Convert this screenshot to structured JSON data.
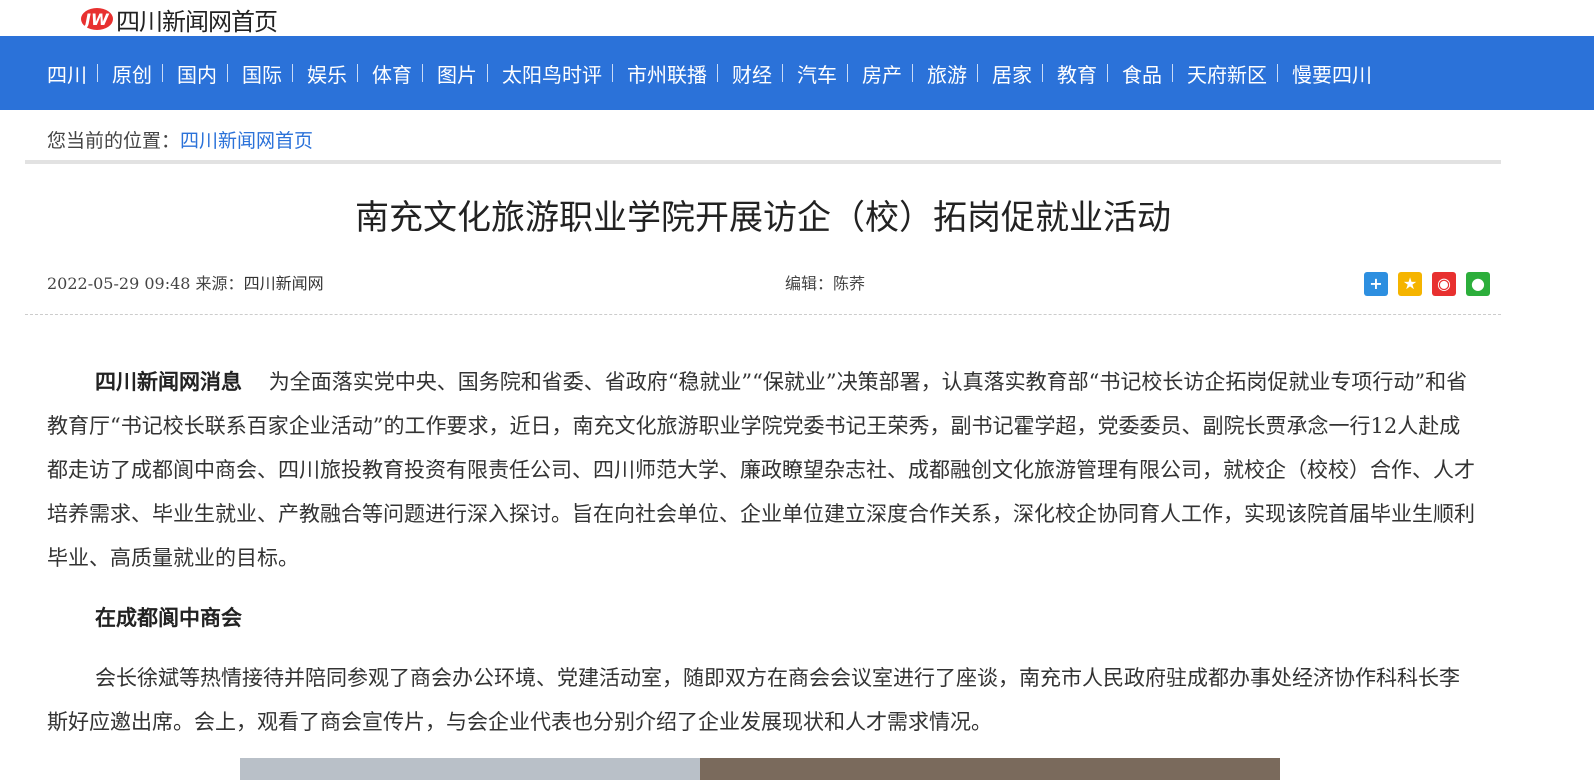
{
  "site": {
    "logo_text": "四川新闻网首页"
  },
  "nav": {
    "items": [
      {
        "label": "四川"
      },
      {
        "label": "原创"
      },
      {
        "label": "国内"
      },
      {
        "label": "国际"
      },
      {
        "label": "娱乐"
      },
      {
        "label": "体育"
      },
      {
        "label": "图片"
      },
      {
        "label": "太阳鸟时评"
      },
      {
        "label": "市州联播"
      },
      {
        "label": "财经"
      },
      {
        "label": "汽车"
      },
      {
        "label": "房产"
      },
      {
        "label": "旅游"
      },
      {
        "label": "居家"
      },
      {
        "label": "教育"
      },
      {
        "label": "食品"
      },
      {
        "label": "天府新区"
      },
      {
        "label": "慢要四川"
      }
    ]
  },
  "breadcrumb": {
    "prefix": "您当前的位置：",
    "link": "四川新闻网首页"
  },
  "article": {
    "title": "南充文化旅游职业学院开展访企（校）拓岗促就业活动",
    "datetime": "2022-05-29 09:48",
    "source_label": "来源：",
    "source": "四川新闻网",
    "editor": "编辑：陈荞",
    "lead_bold": "四川新闻网消息",
    "para1": "为全面落实党中央、国务院和省委、省政府“稳就业”“保就业”决策部署，认真落实教育部“书记校长访企拓岗促就业专项行动”和省教育厅“书记校长联系百家企业活动”的工作要求，近日，南充文化旅游职业学院党委书记王荣秀，副书记霍学超，党委委员、副院长贾承念一行12人赴成都走访了成都阆中商会、四川旅投教育投资有限责任公司、四川师范大学、廉政瞭望杂志社、成都融创文化旅游管理有限公司，就校企（校校）合作、人才培养需求、毕业生就业、产教融合等问题进行深入探讨。旨在向社会单位、企业单位建立深度合作关系，深化校企协同育人工作，实现该院首届毕业生顺利毕业、高质量就业的目标。",
    "subhead": "在成都阆中商会",
    "para2": "会长徐斌等热情接待并陪同参观了商会办公环境、党建活动室，随即双方在商会会议室进行了座谈，南充市人民政府驻成都办事处经济协作科科长李斯好应邀出席。会上，观看了商会宣传片，与会企业代表也分别介绍了企业发展现状和人才需求情况。"
  },
  "share": {
    "icons": [
      "plus-share-icon",
      "qzone-icon",
      "weibo-icon",
      "wechat-icon"
    ],
    "colors": [
      "#2d8fe0",
      "#f5b400",
      "#e8302f",
      "#2cae3b"
    ]
  }
}
